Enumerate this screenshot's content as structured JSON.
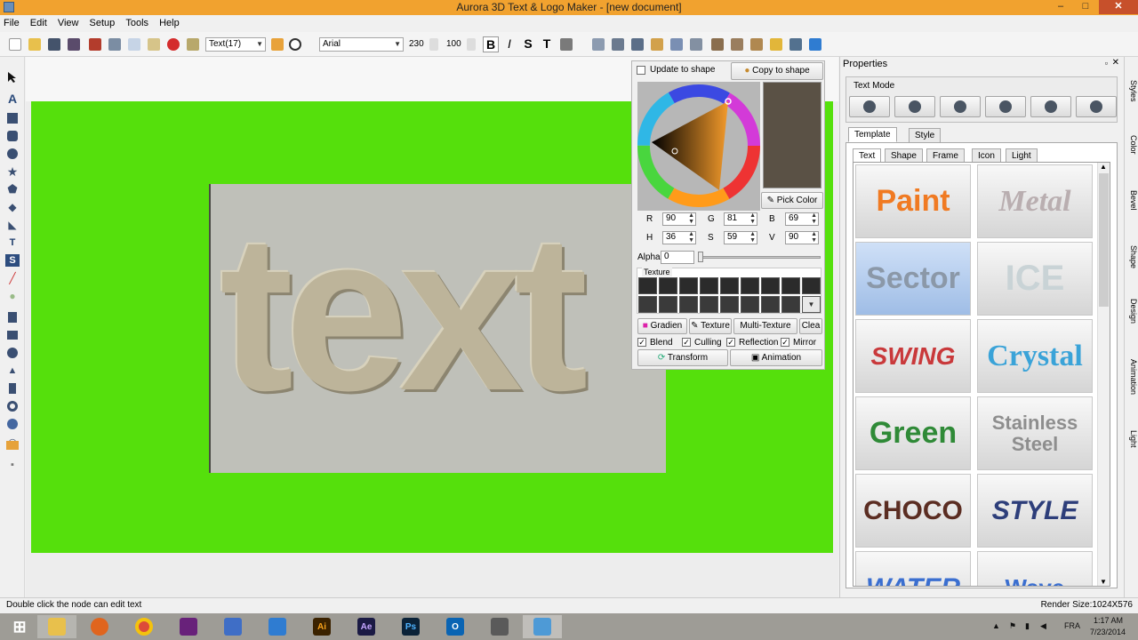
{
  "window": {
    "title": "Aurora 3D Text & Logo Maker - [new document]",
    "min": "–",
    "max": "□",
    "close": "✕"
  },
  "menus": [
    "File",
    "Edit",
    "View",
    "Setup",
    "Tools",
    "Help"
  ],
  "toolbar": {
    "text_style_select": "Text(17)",
    "font_select": "Arial",
    "size_value": "230",
    "spacing_value": "100",
    "bold": "B",
    "italic": "I",
    "strike": "S",
    "ttext": "T"
  },
  "canvas": {
    "art_text": "text",
    "stage_color": "#55e00c"
  },
  "color_panel": {
    "update_to_shape": "Update to shape",
    "copy_to_shape": "Copy to shape",
    "pick_color": "Pick Color",
    "swatch_color": "#5a5145",
    "r_label": "R",
    "r": "90",
    "g_label": "G",
    "g": "81",
    "b_label": "B",
    "b": "69",
    "h_label": "H",
    "h": "36",
    "s_label": "S",
    "s": "59",
    "v_label": "V",
    "v": "90",
    "alpha_label": "Alpha",
    "alpha": "0",
    "texture_label": "Texture",
    "gradient": "Gradien",
    "texture": "Texture",
    "multi_texture": "Multi-Texture",
    "clear": "Clea",
    "blend": "Blend",
    "culling": "Culling",
    "reflection": "Reflection",
    "mirror": "Mirror",
    "transform": "Transform",
    "animation": "Animation"
  },
  "properties": {
    "title": "Properties",
    "text_mode": "Text Mode",
    "tab_template": "Template",
    "tab_style": "Style",
    "subtabs": [
      "Text",
      "Shape",
      "Frame",
      "Icon",
      "Light"
    ],
    "gallery": [
      {
        "label": "Paint",
        "color": "#f07a22"
      },
      {
        "label": "Metal",
        "color": "#b9aeb0"
      },
      {
        "label": "Sector",
        "color": "#8b98a8"
      },
      {
        "label": "ICE",
        "color": "#c9d3d6"
      },
      {
        "label": "SWING",
        "color": "#c9393b"
      },
      {
        "label": "Crystal",
        "color": "#3aa3d8"
      },
      {
        "label": "Green",
        "color": "#2f8a37"
      },
      {
        "label": "Stainless Steel",
        "color": "#8e8e8e"
      },
      {
        "label": "CHOCO",
        "color": "#5b2d22"
      },
      {
        "label": "STYLE",
        "color": "#2d3e7a"
      },
      {
        "label": "WATER",
        "color": "#3b6fd0"
      },
      {
        "label": "Wave",
        "color": "#3b6fd0"
      }
    ]
  },
  "side_tabs": [
    "Styles",
    "Color",
    "Bevel",
    "Shape",
    "Design",
    "Animation",
    "Light"
  ],
  "status": {
    "hint": "Double click the node can edit text",
    "render_size": "Render Size:1024X576"
  },
  "taskbar": {
    "ai": "Ai",
    "ae": "Ae",
    "ps": "Ps",
    "ol": "O",
    "lang": "FRA",
    "time": "1:17 AM",
    "date": "7/23/2014"
  }
}
